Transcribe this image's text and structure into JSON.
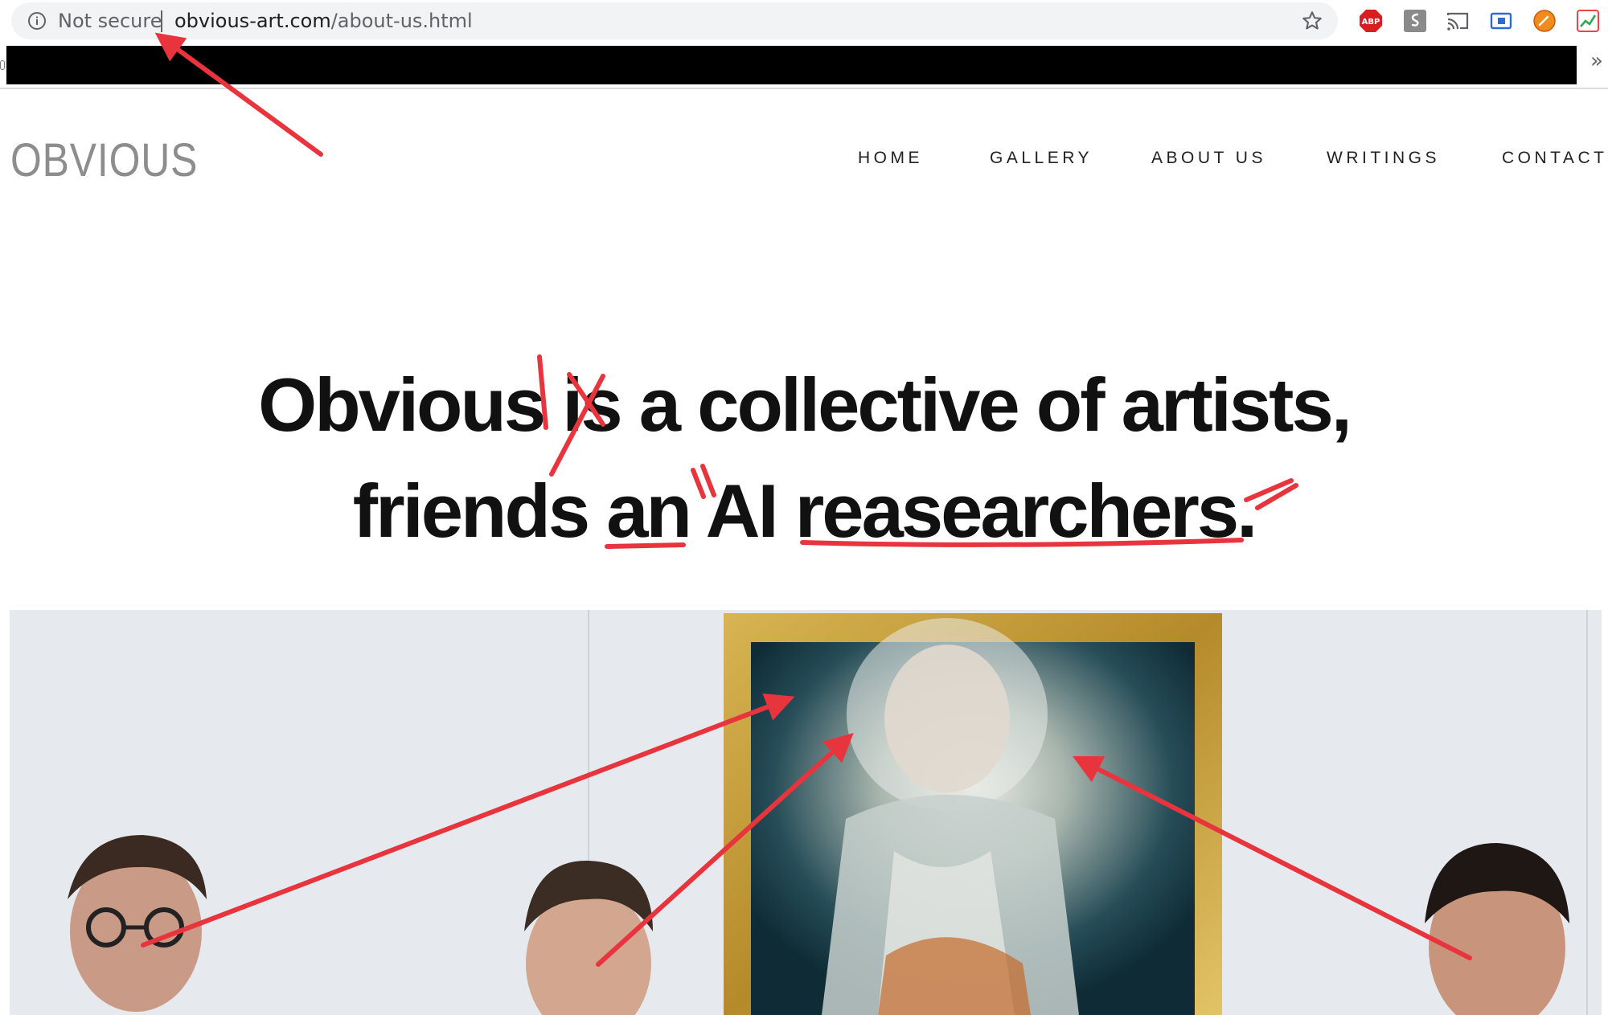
{
  "browser": {
    "security_label": "Not secure",
    "url_domain": "obvious-art.com",
    "url_path": "/about-us.html",
    "bookmarks_more": "»",
    "extensions": [
      "adblock-plus-icon",
      "script-icon",
      "cast-icon",
      "screen-capture-icon",
      "colorpicker-icon",
      "chart-extension-icon"
    ],
    "adblock_badge": "ABP"
  },
  "site": {
    "logo": "OBVIOUS",
    "nav": [
      "HOME",
      "GALLERY",
      "ABOUT US",
      "WRITINGS",
      "CONTACT"
    ]
  },
  "headline": {
    "line1": "Obvious is a collective of artists,",
    "line2": "friends an AI reasearchers."
  },
  "colors": {
    "annotation_red": "#e8343c",
    "frame_gold": "#c9a23c",
    "logo_gray": "#8d8d8d"
  }
}
